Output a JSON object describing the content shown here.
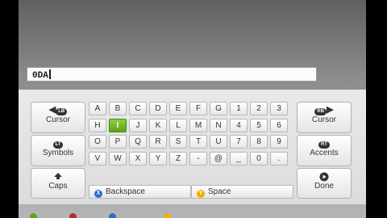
{
  "input": {
    "value": "0DA"
  },
  "keys": {
    "row1": [
      "A",
      "B",
      "C",
      "D",
      "E",
      "F",
      "G",
      "1",
      "2",
      "3"
    ],
    "row2": [
      "H",
      "I",
      "J",
      "K",
      "L",
      "M",
      "N",
      "4",
      "5",
      "6"
    ],
    "row3": [
      "O",
      "P",
      "Q",
      "R",
      "S",
      "T",
      "U",
      "7",
      "8",
      "9"
    ],
    "row4": [
      "V",
      "W",
      "X",
      "Y",
      "Z",
      "-",
      "@",
      "_",
      "0",
      "."
    ],
    "selected": "I"
  },
  "left_buttons": {
    "cursor_left": {
      "label": "Cursor",
      "badge": "LB"
    },
    "symbols": {
      "label": "Symbols",
      "badge": "LT"
    },
    "caps": {
      "label": "Caps"
    }
  },
  "right_buttons": {
    "cursor_right": {
      "label": "Cursor",
      "badge": "RB"
    },
    "accents": {
      "label": "Accents",
      "badge": "RT"
    },
    "done": {
      "label": "Done"
    }
  },
  "bottom": {
    "backspace": {
      "label": "Backspace",
      "button": "X"
    },
    "space": {
      "label": "Space",
      "button": "Y"
    }
  },
  "colors": {
    "selected": "#6ab823",
    "x_button": "#2c6dc8",
    "y_button": "#f0b000"
  }
}
